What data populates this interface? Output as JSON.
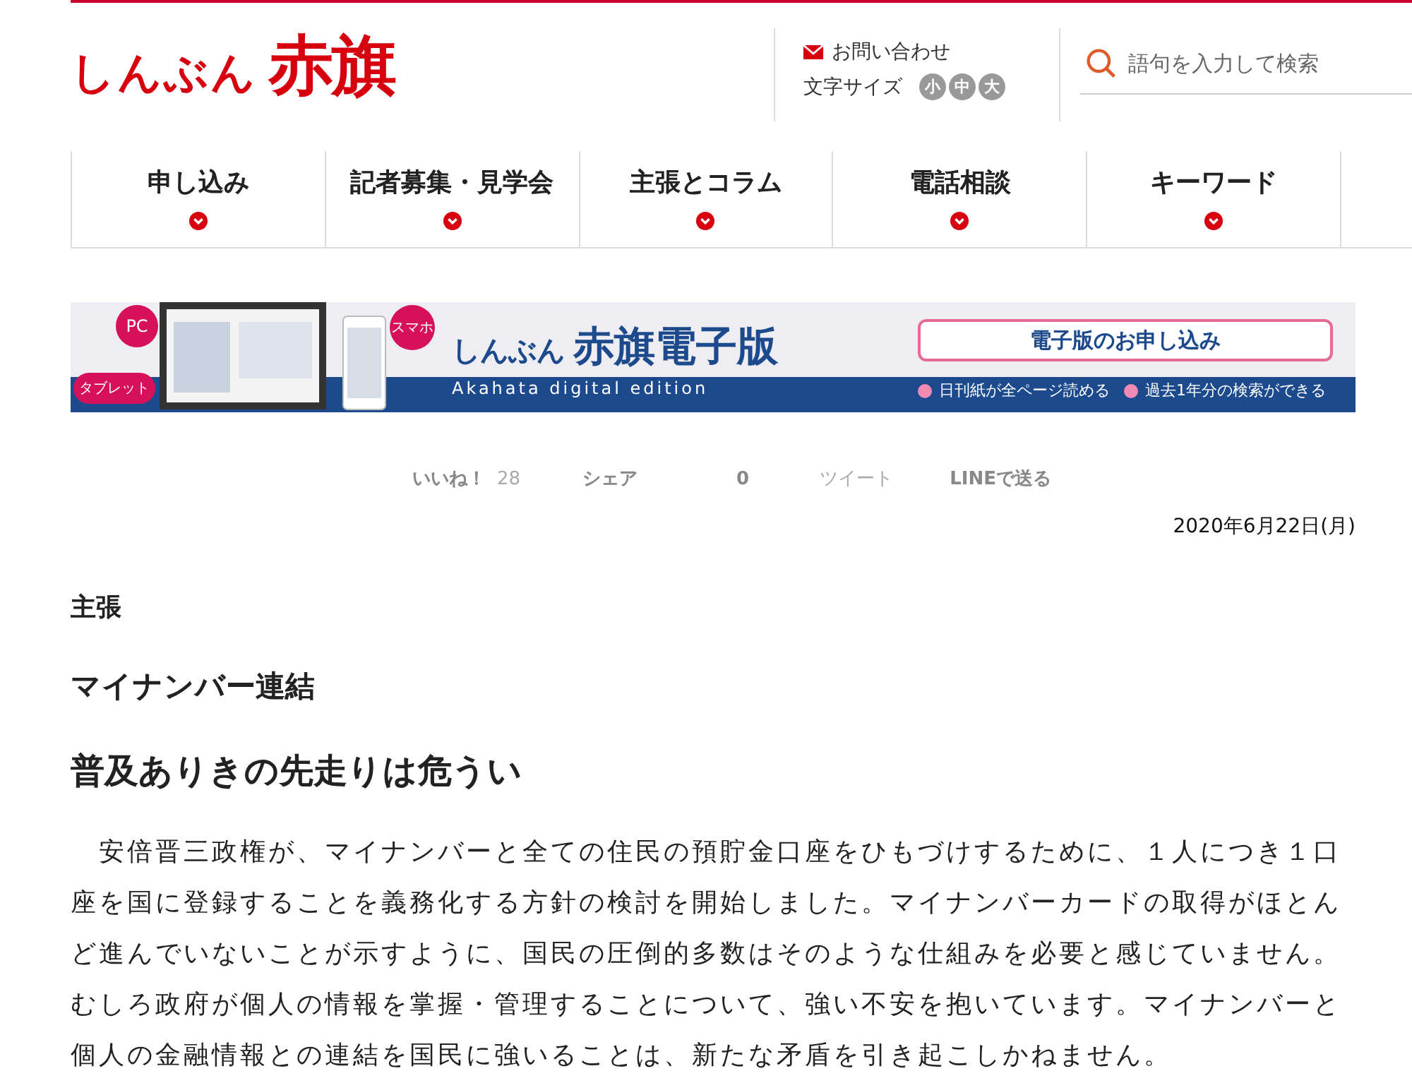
{
  "header": {
    "logo_kana": "しんぶん",
    "logo_kanji": "赤旗",
    "contact_link": "お問い合わせ",
    "font_size_label": "文字サイズ",
    "font_sizes": [
      {
        "label": "小",
        "selected": false
      },
      {
        "label": "中",
        "selected": false
      },
      {
        "label": "大",
        "selected": false
      }
    ],
    "search": {
      "placeholder": "語句を入力して検索"
    }
  },
  "nav": [
    {
      "label": "申し込み"
    },
    {
      "label": "記者募集・見学会"
    },
    {
      "label": "主張とコラム"
    },
    {
      "label": "電話相談"
    },
    {
      "label": "キーワード"
    }
  ],
  "banner": {
    "bubbles": [
      "PC",
      "タブレット",
      "スマホ"
    ],
    "title_kana": "しんぶん",
    "title_kanji": "赤旗電子版",
    "subtitle": "Akahata digital edition",
    "button": "電子版のお申し込み",
    "features": [
      "日刊紙が全ページ読める",
      "過去1年分の検索ができる"
    ]
  },
  "social": {
    "like": "いいね！",
    "like_count": "28",
    "share": "シェア",
    "share_count": "0",
    "tweet": "ツイート",
    "line": "LINEで送る"
  },
  "article": {
    "date": "2020年6月22日(月)",
    "category": "主張",
    "headline": "マイナンバー連結",
    "subheadline": "普及ありきの先走りは危うい",
    "body": "　安倍晋三政権が、マイナンバーと全ての住民の預貯金口座をひもづけするために、１人につき１口座を国に登録することを義務化する方針の検討を開始しました。マイナンバーカードの取得がほとんど進んでいないことが示すように、国民の圧倒的多数はそのような仕組みを必要と感じていません。むしろ政府が個人の情報を掌握・管理することについて、強い不安を抱いています。マイナンバーと個人の金融情報との連結を国民に強いることは、新たな矛盾を引き起こしかねません。"
  }
}
